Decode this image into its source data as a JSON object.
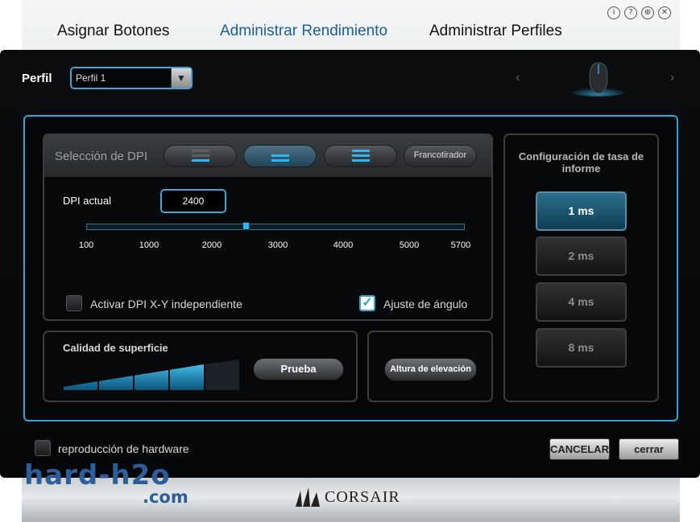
{
  "window": {
    "icons": [
      "info-icon",
      "help-icon",
      "globe-icon",
      "close-icon"
    ],
    "icon_glyphs": [
      "i",
      "?",
      "⊕",
      "✕"
    ]
  },
  "tabs": [
    {
      "label": "Asignar Botones",
      "active": false
    },
    {
      "label": "Administrar Rendimiento",
      "active": true
    },
    {
      "label": "Administrar Perfiles",
      "active": false
    }
  ],
  "profile": {
    "label": "Perfil",
    "selected": "Perfil 1"
  },
  "dpi": {
    "section_label": "Selección de DPI",
    "sniper_label": "Francotirador",
    "current_label": "DPI actual",
    "current_value": "2400",
    "slider_fraction": 0.42,
    "ticks": [
      "100",
      "1000",
      "2000",
      "3000",
      "4000",
      "5000",
      "5700"
    ],
    "independent_xy_label": "Activar DPI X-Y independiente",
    "independent_xy_checked": false,
    "angle_snap_label": "Ajuste de ángulo",
    "angle_snap_checked": true
  },
  "surface": {
    "title": "Calidad de superficie",
    "test_button": "Prueba",
    "quality_bars_filled": 4,
    "quality_bars_total": 5
  },
  "lift": {
    "button": "Altura de elevación"
  },
  "report_rate": {
    "title": "Configuración de tasa de informe",
    "options": [
      "1 ms",
      "2 ms",
      "4 ms",
      "8 ms"
    ],
    "selected": "1 ms"
  },
  "footer": {
    "hardware_playback_label": "reproducción de hardware",
    "cancel": "CANCELAR",
    "close": "cerrar"
  },
  "branding": {
    "watermark_line1": "hard-h2o",
    "watermark_line2": ".com",
    "corsair": "CORSAIR"
  },
  "colors": {
    "accent": "#2ea6dd",
    "active_tab": "#1a5f9c",
    "watermark": "#2b5e9a"
  }
}
